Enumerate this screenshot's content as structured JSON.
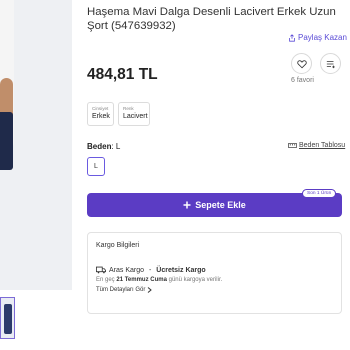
{
  "product": {
    "title": "Haşema Mavi Dalga Desenli Lacivert Erkek Uzun Şort (547639932)",
    "price": "484,81 TL",
    "share_label": "Paylaş Kazan",
    "favorites_count": "6 favori",
    "attributes": [
      {
        "label": "Cinsiyet",
        "value": "Erkek"
      },
      {
        "label": "Renk",
        "value": "Lacivert"
      }
    ]
  },
  "size": {
    "label_prefix": "Beden",
    "label_value": ": L",
    "guide_label": "Beden Tablosu",
    "options": [
      "L"
    ]
  },
  "cart": {
    "add_label": "Sepete Ekle",
    "badge": "Son 1 Ürün"
  },
  "cargo": {
    "title": "Kargo Bilgileri",
    "carrier": "Aras Kargo",
    "separator": " - ",
    "free_label": "Ücretsiz Kargo",
    "eta_prefix": "En geç ",
    "eta_date": "21 Temmuz Cuma",
    "eta_suffix": " günü kargoya verilir.",
    "details_label": "Tüm Detayları Gör"
  },
  "icons": {
    "share": "share-icon",
    "favorite": "heart-icon",
    "list": "list-add-icon",
    "ruler": "ruler-icon",
    "truck": "truck-icon",
    "plus": "plus-icon",
    "chevron": "chevron-right-icon"
  },
  "colors": {
    "accent": "#5b3cc4",
    "link": "#5a4bd6"
  }
}
